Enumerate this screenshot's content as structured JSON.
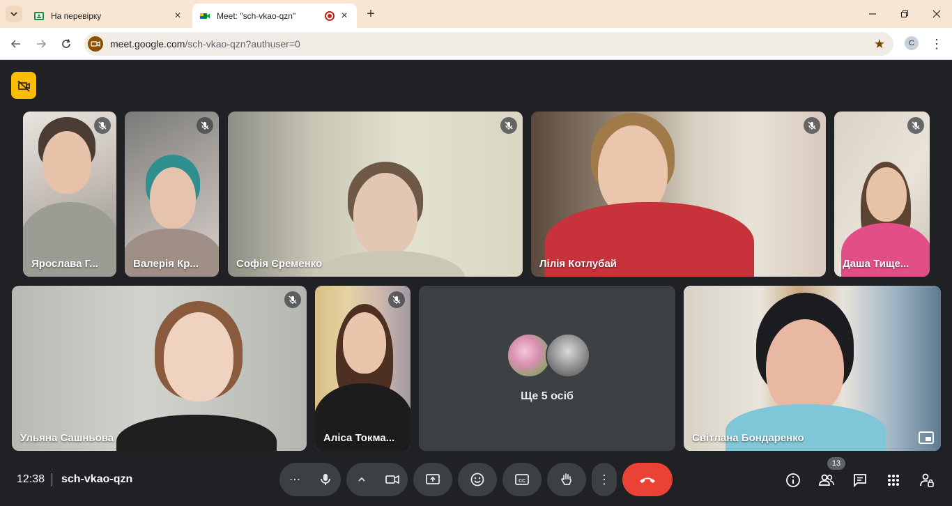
{
  "browser": {
    "tabs": [
      {
        "title": "На перевірку",
        "active": false
      },
      {
        "title": "Meet: \"sch-vkao-qzn\"",
        "active": true,
        "recording": true
      }
    ],
    "url_host": "meet.google.com",
    "url_path": "/sch-vkao-qzn?authuser=0",
    "profile_initial": "C"
  },
  "meeting": {
    "time": "12:38",
    "code": "sch-vkao-qzn",
    "participant_count": "13",
    "more_label": "Ще 5 осіб"
  },
  "participants": [
    {
      "name": "Ярослава Г...",
      "muted": true
    },
    {
      "name": "Валерія Кр...",
      "muted": true
    },
    {
      "name": "Софія Єременко",
      "muted": true
    },
    {
      "name": "Лілія Котлубай",
      "muted": true
    },
    {
      "name": "Даша Тище...",
      "muted": true
    },
    {
      "name": "Ульяна Сашньова",
      "muted": true
    },
    {
      "name": "Аліса Токма...",
      "muted": true
    },
    {
      "name": "Світлана Бондаренко",
      "muted": false,
      "speaking": true
    }
  ],
  "colors": {
    "background": "#202124",
    "control": "#3c4043",
    "end_call": "#ea4335",
    "recording_badge": "#fbbc04",
    "speaking_outline": "#aecbfa"
  }
}
